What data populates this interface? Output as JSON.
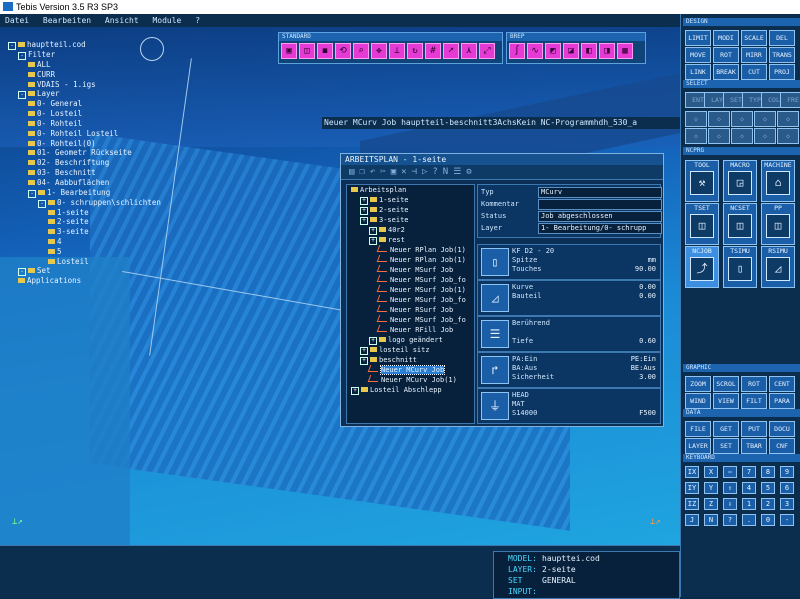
{
  "window": {
    "title": "Tebis Version 3.5 R3 SP3"
  },
  "menu": [
    "Datei",
    "Bearbeiten",
    "Ansicht",
    "Module",
    "?"
  ],
  "tree": [
    {
      "label": "hauptteil.cod",
      "depth": 0,
      "type": "pm-folder"
    },
    {
      "label": "Filter",
      "depth": 1,
      "type": "pm"
    },
    {
      "label": "ALL",
      "depth": 2,
      "type": "folder"
    },
    {
      "label": "CURR",
      "depth": 2,
      "type": "folder"
    },
    {
      "label": "VDAIS - 1.igs",
      "depth": 2,
      "type": "folder"
    },
    {
      "label": "Layer",
      "depth": 1,
      "type": "pm-folder"
    },
    {
      "label": "0- General",
      "depth": 2,
      "type": "folder"
    },
    {
      "label": "0- Losteil",
      "depth": 2,
      "type": "folder"
    },
    {
      "label": "0- Rohteil",
      "depth": 2,
      "type": "folder"
    },
    {
      "label": "0- Rohteil Losteil",
      "depth": 2,
      "type": "folder"
    },
    {
      "label": "0- Rohteil(0)",
      "depth": 2,
      "type": "folder"
    },
    {
      "label": "01- Geometr Rückseite",
      "depth": 2,
      "type": "folder"
    },
    {
      "label": "02- Beschriftung",
      "depth": 2,
      "type": "folder"
    },
    {
      "label": "03- Beschnitt",
      "depth": 2,
      "type": "folder"
    },
    {
      "label": "04- Aabbuflächen",
      "depth": 2,
      "type": "folder"
    },
    {
      "label": "1- Bearbeitung",
      "depth": 2,
      "type": "pm-folder"
    },
    {
      "label": "0- schruppen\\schlichten",
      "depth": 3,
      "type": "pm-folder"
    },
    {
      "label": "1-seite",
      "depth": 4,
      "type": "folder"
    },
    {
      "label": "2-seite",
      "depth": 4,
      "type": "folder"
    },
    {
      "label": "3-seite",
      "depth": 4,
      "type": "folder"
    },
    {
      "label": "4",
      "depth": 4,
      "type": "folder"
    },
    {
      "label": "5",
      "depth": 4,
      "type": "folder"
    },
    {
      "label": "Losteil",
      "depth": 4,
      "type": "folder"
    },
    {
      "label": "Set",
      "depth": 1,
      "type": "pm-folder"
    },
    {
      "label": "Applications",
      "depth": 1,
      "type": "folder"
    }
  ],
  "toolbars": {
    "standard": {
      "title": "STANDARD",
      "icons": [
        "cube-icon",
        "cube-wire-icon",
        "cube-shade-icon",
        "rotate-icon",
        "zoom-icon",
        "pan-icon",
        "axis-icon",
        "refresh-icon",
        "grid-icon",
        "arrow-icon",
        "triad-icon",
        "fit-icon"
      ]
    },
    "brep": {
      "title": "BREP",
      "icons": [
        "curve-icon",
        "spline-icon",
        "surface-icon",
        "surface2-icon",
        "surface3-icon",
        "surface4-icon",
        "surface5-icon"
      ]
    }
  },
  "path_label": "Neuer MCurv Job hauptteil-beschnitt3AchsKein NC-Programmhdh_530_a",
  "dialog": {
    "title": "ARBEITSPLAN - 1-seite",
    "tree": [
      {
        "label": "Arbeitsplan",
        "depth": 0,
        "kind": "folder"
      },
      {
        "label": "1-seite",
        "depth": 1,
        "kind": "pm-folder"
      },
      {
        "label": "2-seite",
        "depth": 1,
        "kind": "pm-folder"
      },
      {
        "label": "3-seite",
        "depth": 1,
        "kind": "pm-folder"
      },
      {
        "label": "40r2",
        "depth": 2,
        "kind": "pm-folder"
      },
      {
        "label": "rest",
        "depth": 2,
        "kind": "pm-folder"
      },
      {
        "label": "Neuer RPlan Job(1)",
        "depth": 3,
        "kind": "job"
      },
      {
        "label": "Neuer RPlan Job(1)",
        "depth": 3,
        "kind": "job"
      },
      {
        "label": "Neuer MSurf Job",
        "depth": 3,
        "kind": "job"
      },
      {
        "label": "Neuer MSurf Job_fo",
        "depth": 3,
        "kind": "job"
      },
      {
        "label": "Neuer MSurf Job(1)",
        "depth": 3,
        "kind": "job"
      },
      {
        "label": "Neuer MSurf Job_fo",
        "depth": 3,
        "kind": "job"
      },
      {
        "label": "Neuer RSurf Job",
        "depth": 3,
        "kind": "job"
      },
      {
        "label": "Neuer MSurf Job_fo",
        "depth": 3,
        "kind": "job"
      },
      {
        "label": "Neuer RFill Job",
        "depth": 3,
        "kind": "job"
      },
      {
        "label": "logo geändert",
        "depth": 2,
        "kind": "pm-folder"
      },
      {
        "label": "losteil sitz",
        "depth": 1,
        "kind": "pm-folder"
      },
      {
        "label": "beschnitt",
        "depth": 1,
        "kind": "pm-folder"
      },
      {
        "label": "Neuer MCurv Job",
        "depth": 2,
        "kind": "job",
        "selected": true
      },
      {
        "label": "Neuer MCurv Job(1)",
        "depth": 2,
        "kind": "job"
      },
      {
        "label": "Losteil Abschlepp",
        "depth": 0,
        "kind": "pm-folder"
      }
    ],
    "props": [
      {
        "label": "Typ",
        "value": "MCurv"
      },
      {
        "label": "Kommentar",
        "value": ""
      },
      {
        "label": "Status",
        "value": "Job abgeschlossen"
      },
      {
        "label": "Layer",
        "value": "1- Bearbeitung/0- schrupp"
      }
    ],
    "panels": [
      {
        "icon": "tool-icon",
        "lines": [
          [
            "KF D2 - 20",
            ""
          ],
          [
            "Spitze",
            "mm"
          ],
          [
            "Touches",
            "90.00"
          ]
        ]
      },
      {
        "icon": "curve-panel-icon",
        "lines": [
          [
            "Kurve",
            "0.00"
          ],
          [
            "Bauteil",
            "0.00"
          ]
        ]
      },
      {
        "icon": "depth-icon",
        "lines": [
          [
            "Berührend",
            ""
          ],
          [
            "",
            ""
          ],
          [
            "Tiefe",
            "0.60"
          ]
        ]
      },
      {
        "icon": "approach-icon",
        "lines": [
          [
            "PA:Ein",
            "PE:Ein"
          ],
          [
            "BA:Aus",
            "BE:Aus"
          ],
          [
            "Sicherheit",
            "3.00"
          ]
        ]
      },
      {
        "icon": "head-icon",
        "lines": [
          [
            "HEAD",
            ""
          ],
          [
            "MAT",
            ""
          ],
          [
            "S14000",
            "F500"
          ]
        ]
      }
    ]
  },
  "palette": {
    "design_title": "DESIGN",
    "design": [
      "LIMIT",
      "MODI",
      "SCALE",
      "DEL",
      "MOVE",
      "ROT",
      "MIRR",
      "TRANS",
      "LINK",
      "BREAK",
      "CUT",
      "PROJ"
    ],
    "select_title": "SELECT",
    "select": [
      "ENT",
      "LAY",
      "SET",
      "TYP",
      "COL",
      "FRE"
    ],
    "nc_title": "NCPRG",
    "nc": [
      "TOOL",
      "MACRO",
      "MACHINE",
      "TSET",
      "NCSET",
      "PP",
      "NCJOB",
      "TSIMU",
      "RSIMU"
    ],
    "graphic_title": "GRAPHIC",
    "graphic": [
      "ZOOM",
      "SCROL",
      "ROT",
      "CENT",
      "WIND",
      "VIEW",
      "FILT",
      "PARA"
    ],
    "data_title": "DATA",
    "data": [
      "FILE",
      "GET",
      "PUT",
      "DOCU",
      "LAYER",
      "SET",
      "TBAR",
      "CNF"
    ],
    "keyboard_title": "KEYBOARD",
    "keyboard": [
      "IX",
      "X",
      "⇦",
      "7",
      "8",
      "9",
      "IY",
      "Y",
      "⇧",
      "4",
      "5",
      "6",
      "IZ",
      "Z",
      "⇩",
      "1",
      "2",
      "3",
      "J",
      "N",
      "?",
      ".",
      "0",
      "-"
    ]
  },
  "status": {
    "model_label": "MODEL:",
    "model": "haupttei.cod",
    "layer_label": "LAYER:",
    "layer": "2-seite",
    "set_label": "SET",
    "set": "GENERAL",
    "input_label": "INPUT:",
    "input": ""
  },
  "colors": {
    "accent": "#e63ad4",
    "viewport": "#1360b8",
    "panel": "#0b2d4e"
  }
}
